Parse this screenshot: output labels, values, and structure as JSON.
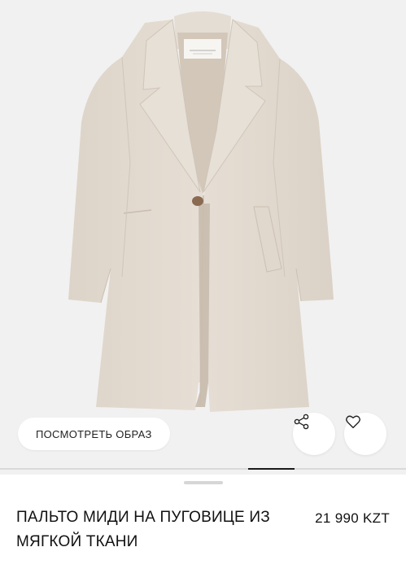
{
  "actions": {
    "look_label": "ПОСМОТРЕТЬ ОБРАЗ",
    "share_icon": "share-icon",
    "favorite_icon": "heart-icon"
  },
  "gallery": {
    "image_progress": 0.11
  },
  "product": {
    "title": "ПАЛЬТО МИДИ НА ПУГОВИЦЕ ИЗ МЯГКОЙ ТКАНИ",
    "price": "21 990 KZT"
  },
  "colors": {
    "coat": "#e3dbd1",
    "background": "#f1f1f1",
    "text": "#111111"
  }
}
